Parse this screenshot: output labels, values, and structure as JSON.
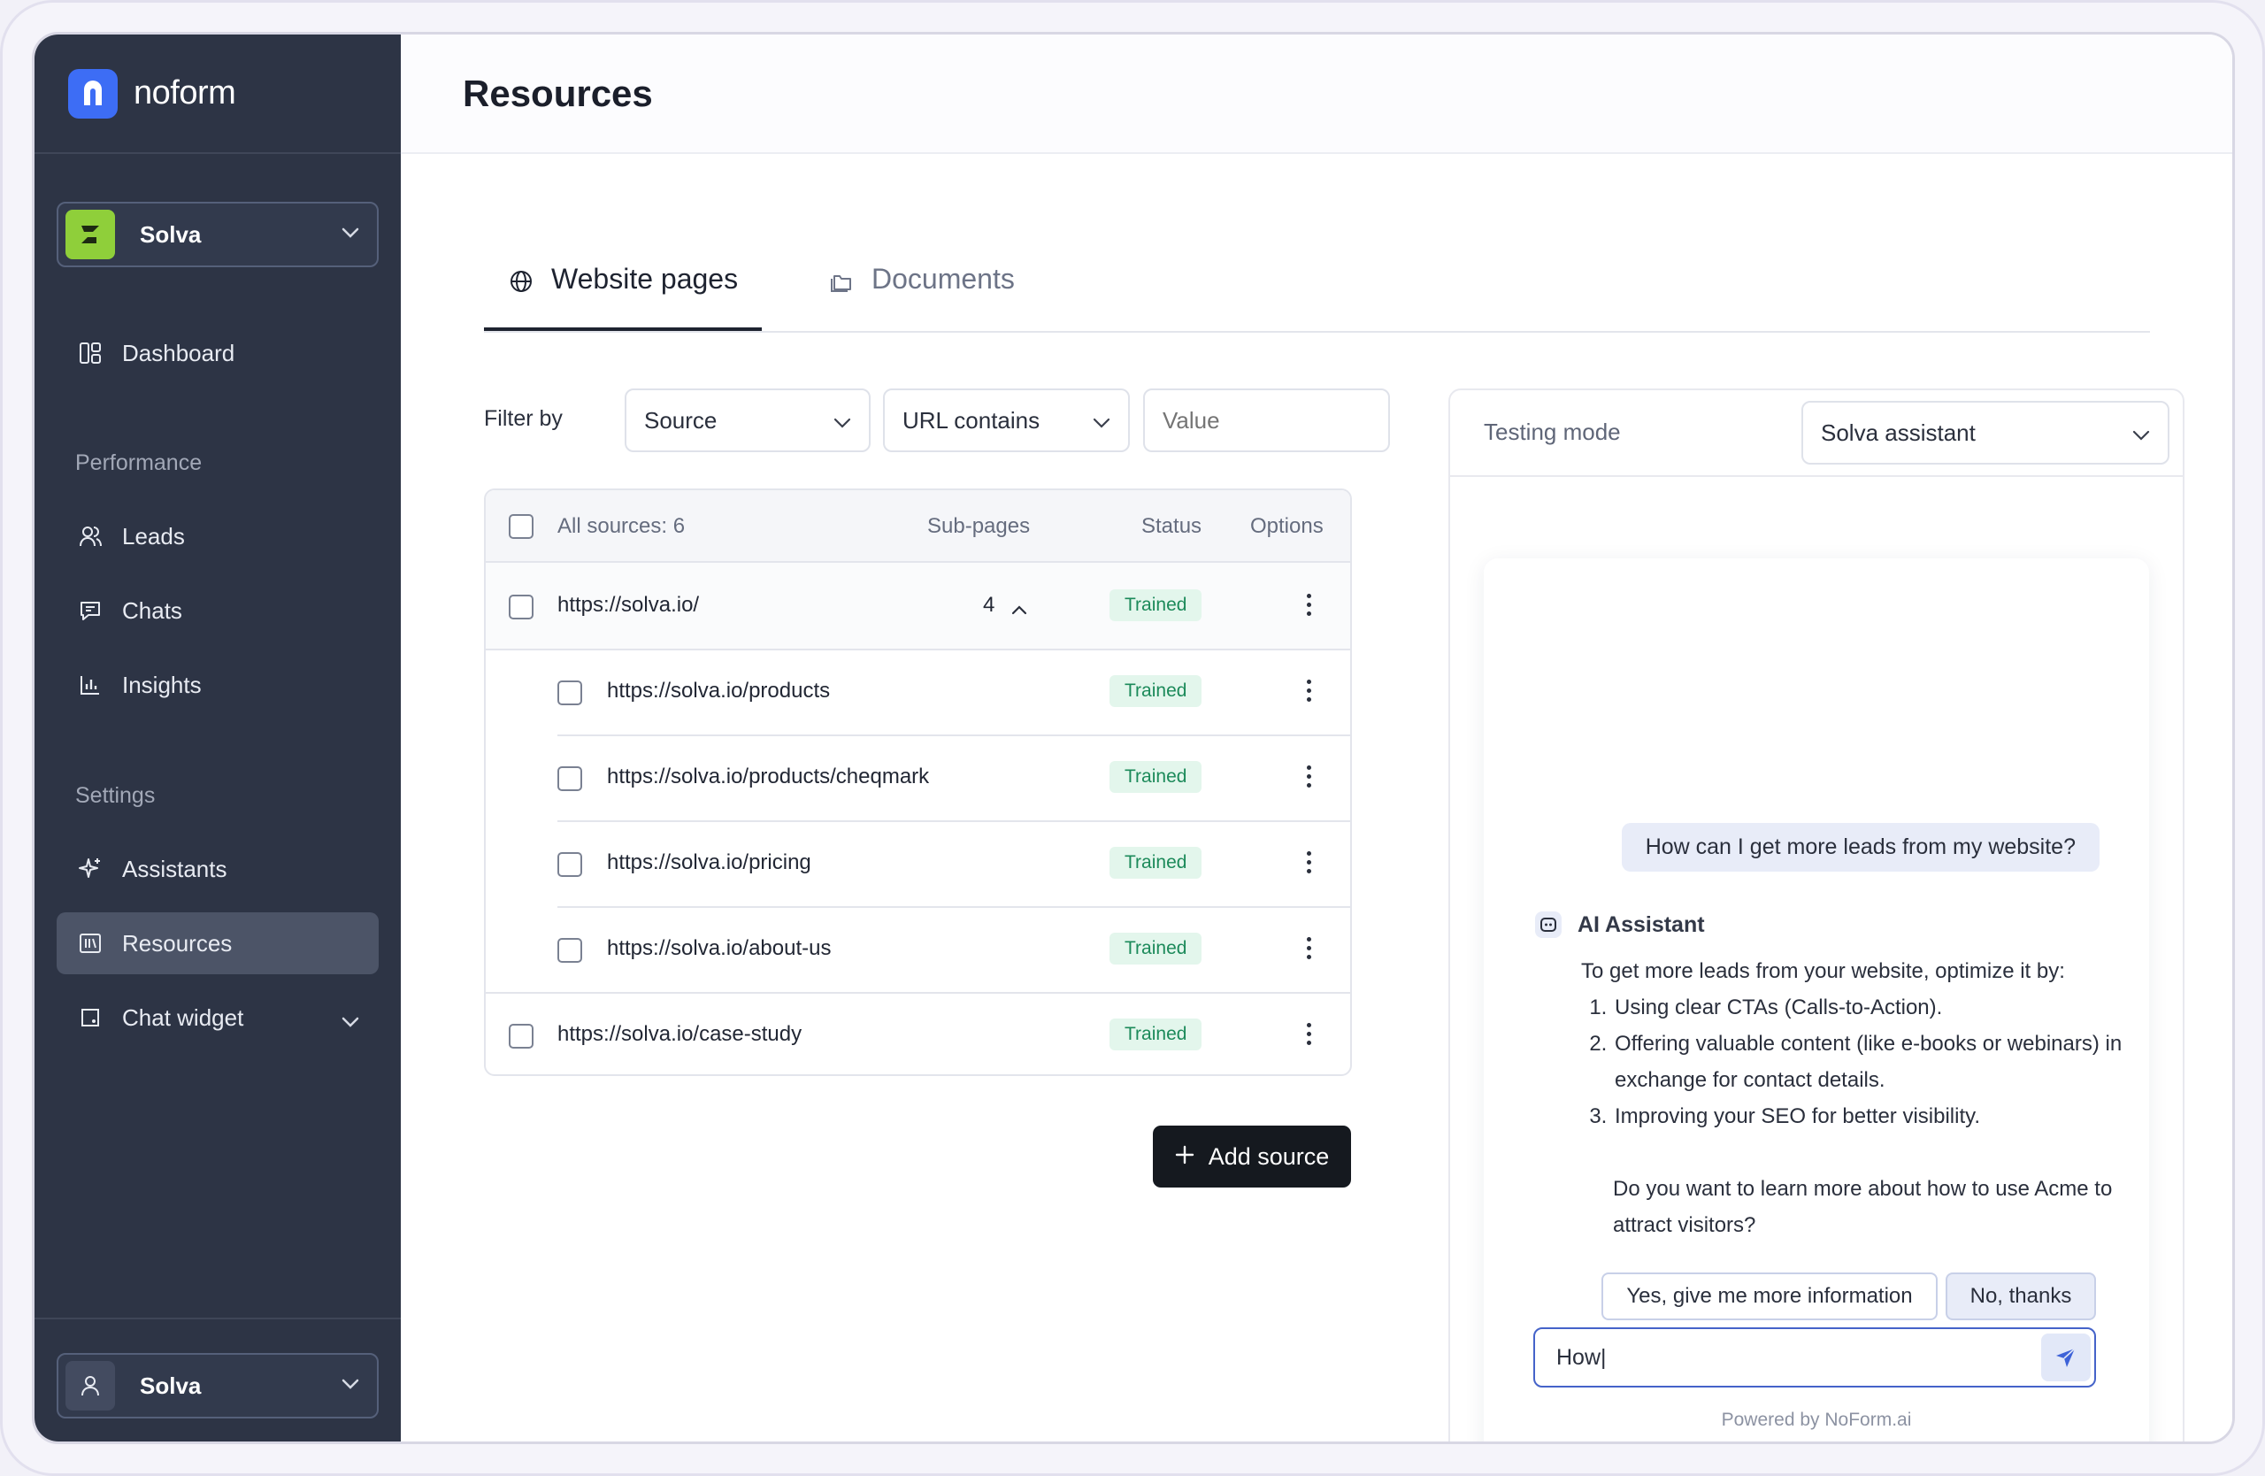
{
  "app": {
    "name": "noform"
  },
  "workspace": {
    "name": "Solva"
  },
  "sidebar": {
    "items": [
      {
        "label": "Dashboard"
      },
      {
        "label": "Leads"
      },
      {
        "label": "Chats"
      },
      {
        "label": "Insights"
      },
      {
        "label": "Assistants"
      },
      {
        "label": "Resources"
      },
      {
        "label": "Chat widget"
      }
    ],
    "sections": {
      "performance": "Performance",
      "settings": "Settings"
    },
    "active": "Resources"
  },
  "user": {
    "name": "Solva"
  },
  "page": {
    "title": "Resources"
  },
  "tabs": [
    {
      "label": "Website pages",
      "active": true
    },
    {
      "label": "Documents",
      "active": false
    }
  ],
  "filters": {
    "label": "Filter by",
    "source": "Source",
    "condition": "URL contains",
    "value_placeholder": "Value"
  },
  "table": {
    "headers": {
      "sources": "All sources: 6",
      "subpages": "Sub-pages",
      "status": "Status",
      "options": "Options"
    },
    "rows": [
      {
        "url": "https://solva.io/",
        "subpages": "4",
        "status": "Trained",
        "expanded": true
      },
      {
        "url": "https://solva.io/products",
        "status": "Trained",
        "child": true
      },
      {
        "url": "https://solva.io/products/cheqmark",
        "status": "Trained",
        "child": true
      },
      {
        "url": "https://solva.io/pricing",
        "status": "Trained",
        "child": true
      },
      {
        "url": "https://solva.io/about-us",
        "status": "Trained",
        "child": true
      },
      {
        "url": "https://solva.io/case-study",
        "status": "Trained"
      }
    ]
  },
  "add_source_label": "Add source",
  "testing": {
    "label": "Testing mode",
    "assistant": "Solva assistant"
  },
  "chat": {
    "user_message": "How can I get more leads from my website?",
    "ai_name": "AI Assistant",
    "ai_intro": "To get more leads from your website, optimize it by:",
    "ai_points": [
      "Using clear CTAs (Calls-to-Action).",
      "Offering valuable content (like e-books or webinars) in exchange for contact details.",
      "Improving your SEO for better visibility."
    ],
    "ai_question": "Do you want to learn more about how to use Acme to attract visitors?",
    "quick_replies": [
      "Yes, give me more information",
      "No, thanks"
    ],
    "input_value": "How|",
    "powered_by": "Powered by NoForm.ai"
  },
  "colors": {
    "sidebar_bg": "#2d3445",
    "brand": "#3d6df5",
    "workspace_logo": "#8fcf3a",
    "trained_badge_bg": "#e3f6ec",
    "trained_badge_text": "#1c8a5a",
    "primary_button": "#15191f"
  }
}
